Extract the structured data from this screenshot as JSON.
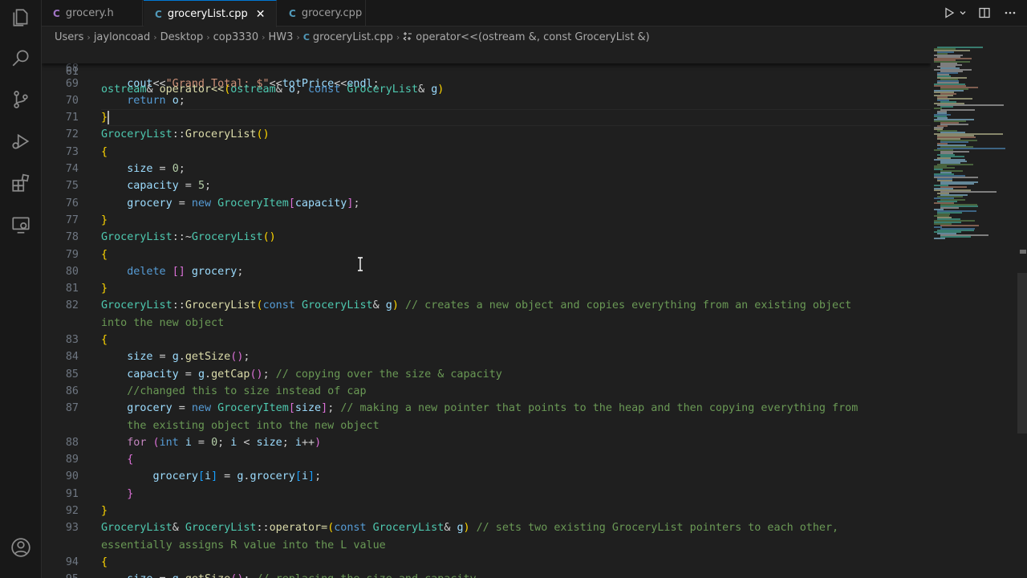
{
  "tabs": [
    {
      "label": "grocery.h",
      "type": "C",
      "type_color": "#a074c4",
      "active": false
    },
    {
      "label": "groceryList.cpp",
      "type": "C",
      "type_color": "#519aba",
      "active": true,
      "close": "✕"
    },
    {
      "label": "grocery.cpp",
      "type": "C",
      "type_color": "#519aba",
      "active": false
    }
  ],
  "tab_actions": [
    "run-icon",
    "chevron-down-icon",
    "split-editor-icon",
    "more-icon"
  ],
  "breadcrumb": {
    "items": [
      "Users",
      "jayloncoad",
      "Desktop",
      "cop3330",
      "HW3",
      "groceryList.cpp",
      "operator<<(ostream &, const GroceryList &)"
    ],
    "separator": "›"
  },
  "activity_bar": [
    "explorer-icon",
    "search-icon",
    "source-control-icon",
    "run-debug-icon",
    "extensions-icon",
    "remote-explorer-icon",
    "account-icon"
  ],
  "sticky_line": {
    "number": "61",
    "text": "ostream& operator<<(ostream& o, const GroceryList& g)"
  },
  "partial_line_number": "68",
  "code_lines": [
    {
      "n": "69",
      "text": "    cout<<\"Grand Total: $\"<<totPrice<<endl;"
    },
    {
      "n": "70",
      "text": "    return o;"
    },
    {
      "n": "71",
      "text": "}"
    },
    {
      "n": "72",
      "text": "GroceryList::GroceryList()"
    },
    {
      "n": "73",
      "text": "{"
    },
    {
      "n": "74",
      "text": "    size = 0;"
    },
    {
      "n": "75",
      "text": "    capacity = 5;"
    },
    {
      "n": "76",
      "text": "    grocery = new GroceryItem[capacity];"
    },
    {
      "n": "77",
      "text": "}"
    },
    {
      "n": "78",
      "text": "GroceryList::~GroceryList()"
    },
    {
      "n": "79",
      "text": "{"
    },
    {
      "n": "80",
      "text": "    delete [] grocery;"
    },
    {
      "n": "81",
      "text": "}"
    },
    {
      "n": "82",
      "text": "GroceryList::GroceryList(const GroceryList& g) // creates a new object and copies everything from an existing object"
    },
    {
      "n": "",
      "text": "into the new object"
    },
    {
      "n": "83",
      "text": "{"
    },
    {
      "n": "84",
      "text": "    size = g.getSize();"
    },
    {
      "n": "85",
      "text": "    capacity = g.getCap(); // copying over the size & capacity"
    },
    {
      "n": "86",
      "text": "    //changed this to size instead of cap"
    },
    {
      "n": "87",
      "text": "    grocery = new GroceryItem[size]; // making a new pointer that points to the heap and then copying everything from"
    },
    {
      "n": "",
      "text": "    the existing object into the new object"
    },
    {
      "n": "88",
      "text": "    for (int i = 0; i < size; i++)"
    },
    {
      "n": "89",
      "text": "    {"
    },
    {
      "n": "90",
      "text": "        grocery[i] = g.grocery[i];"
    },
    {
      "n": "91",
      "text": "    }"
    },
    {
      "n": "92",
      "text": "}"
    },
    {
      "n": "93",
      "text": "GroceryList& GroceryList::operator=(const GroceryList& g) // sets two existing GroceryList pointers to each other,"
    },
    {
      "n": "",
      "text": "essentially assigns R value into the L value"
    },
    {
      "n": "94",
      "text": "{"
    }
  ],
  "partial_bottom_line": {
    "n": "95",
    "text": "    size = g.getSize(); // replacing the size and capacity"
  },
  "colors": {
    "type": "#4ec9b0",
    "function": "#dcdcaa",
    "keyword": "#569cd6",
    "control": "#c586c0",
    "string": "#ce9178",
    "number": "#b5cea8",
    "comment": "#6a9955",
    "variable": "#9cdcfe",
    "accent": "#0078d4"
  }
}
